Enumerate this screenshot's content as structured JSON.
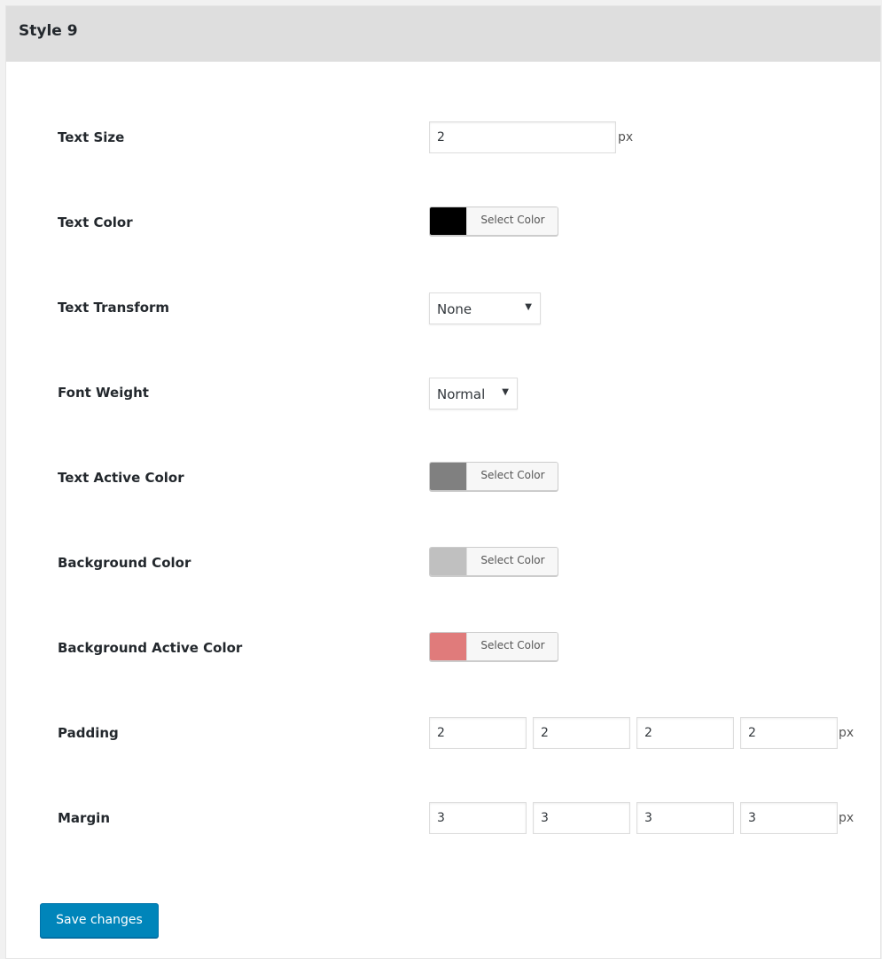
{
  "panel": {
    "title": "Style 9"
  },
  "fields": {
    "text_size": {
      "label": "Text Size",
      "value": "2",
      "unit": "px"
    },
    "text_color": {
      "label": "Text Color",
      "button_label": "Select Color",
      "color": "#000000"
    },
    "text_transform": {
      "label": "Text Transform",
      "selected": "None"
    },
    "font_weight": {
      "label": "Font Weight",
      "selected": "Normal"
    },
    "text_active_color": {
      "label": "Text Active Color",
      "button_label": "Select Color",
      "color": "#808080"
    },
    "background_color": {
      "label": "Background Color",
      "button_label": "Select Color",
      "color": "#c0c0c0"
    },
    "background_active_color": {
      "label": "Background Active Color",
      "button_label": "Select Color",
      "color": "#e07b7b"
    },
    "padding": {
      "label": "Padding",
      "values": [
        "2",
        "2",
        "2",
        "2"
      ],
      "unit": "px"
    },
    "margin": {
      "label": "Margin",
      "values": [
        "3",
        "3",
        "3",
        "3"
      ],
      "unit": "px"
    }
  },
  "actions": {
    "save_label": "Save changes"
  },
  "icons": {
    "dropdown_arrow": "▼"
  }
}
